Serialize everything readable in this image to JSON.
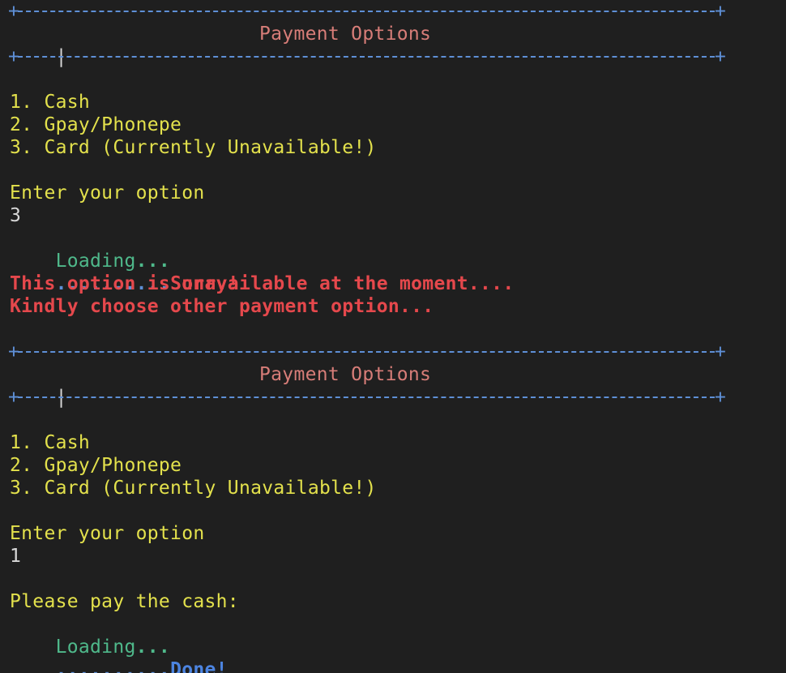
{
  "header_1": {
    "title": "Payment Options"
  },
  "menu_1": {
    "items": [
      "1. Cash",
      "2. Gpay/Phonepe",
      "3. Card (Currently Unavailable!)"
    ]
  },
  "prompt_1": {
    "label": "Enter your option",
    "input_value": "3"
  },
  "loading_1": {
    "text": "Loading",
    "dots": "..."
  },
  "result_1": {
    "dots": "..........",
    "status": "Sorry!",
    "message_1": "This option is unavailable at the moment....",
    "message_2": "Kindly choose other payment option..."
  },
  "header_2": {
    "title": "Payment Options"
  },
  "menu_2": {
    "items": [
      "1. Cash",
      "2. Gpay/Phonepe",
      "3. Card (Currently Unavailable!)"
    ]
  },
  "prompt_2": {
    "label": "Enter your option",
    "input_value": "1"
  },
  "cash_prompt": {
    "text": "Please pay the cash:"
  },
  "loading_2": {
    "text": "Loading",
    "dots": "..."
  },
  "result_2": {
    "dots": "..........",
    "status": "Done!"
  },
  "box": {
    "corner": "+",
    "pipe": "|"
  },
  "colors": {
    "background": "#1f1f1f",
    "border_blue": "#5e8fd6",
    "title_rust": "#d77d78",
    "menu_yellow": "#e3e14c",
    "loading_green": "#4fb98b",
    "error_red": "#e5484c",
    "done_blue": "#4c84e0"
  }
}
